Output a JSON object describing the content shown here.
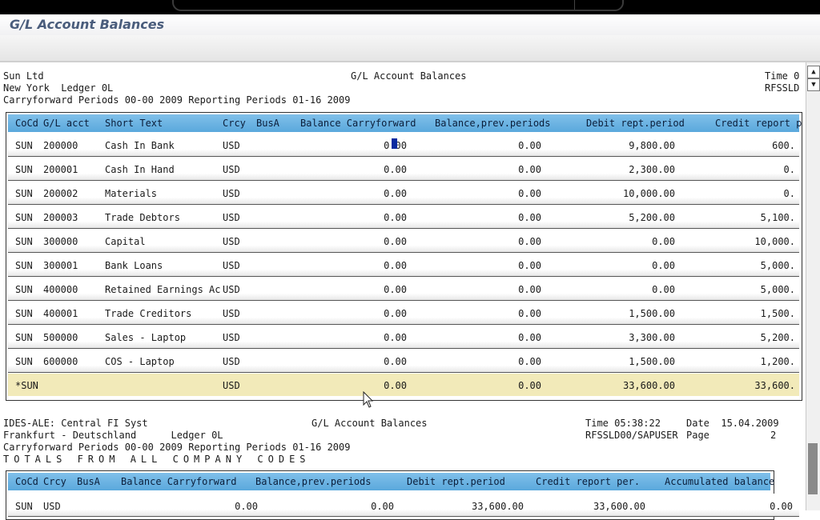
{
  "window": {
    "title": "G/L Account Balances"
  },
  "header1": {
    "company": "Sun Ltd",
    "location": "New York  Ledger 0L",
    "periods": "Carryforward Periods 00-00 2009 Reporting Periods 01-16 2009",
    "title": "G/L Account Balances",
    "time": "Time 0",
    "program": "RFSSLD"
  },
  "table1": {
    "headers": [
      "CoCd",
      "G/L acct",
      "Short Text",
      "Crcy",
      "BusA",
      "Balance Carryforward",
      "Balance,prev.periods",
      "Debit rept.period",
      "Credit report p"
    ],
    "rows": [
      {
        "cocd": "SUN",
        "acct": "200000",
        "text": "Cash In Bank",
        "crcy": "USD",
        "carry": "0.00",
        "prev": "0.00",
        "debit": "9,800.00",
        "credit": "600."
      },
      {
        "cocd": "SUN",
        "acct": "200001",
        "text": "Cash In Hand",
        "crcy": "USD",
        "carry": "0.00",
        "prev": "0.00",
        "debit": "2,300.00",
        "credit": "0."
      },
      {
        "cocd": "SUN",
        "acct": "200002",
        "text": "Materials",
        "crcy": "USD",
        "carry": "0.00",
        "prev": "0.00",
        "debit": "10,000.00",
        "credit": "0."
      },
      {
        "cocd": "SUN",
        "acct": "200003",
        "text": "Trade Debtors",
        "crcy": "USD",
        "carry": "0.00",
        "prev": "0.00",
        "debit": "5,200.00",
        "credit": "5,100."
      },
      {
        "cocd": "SUN",
        "acct": "300000",
        "text": "Capital",
        "crcy": "USD",
        "carry": "0.00",
        "prev": "0.00",
        "debit": "0.00",
        "credit": "10,000."
      },
      {
        "cocd": "SUN",
        "acct": "300001",
        "text": "Bank Loans",
        "crcy": "USD",
        "carry": "0.00",
        "prev": "0.00",
        "debit": "0.00",
        "credit": "5,000."
      },
      {
        "cocd": "SUN",
        "acct": "400000",
        "text": "Retained Earnings Ac",
        "crcy": "USD",
        "carry": "0.00",
        "prev": "0.00",
        "debit": "0.00",
        "credit": "5,000."
      },
      {
        "cocd": "SUN",
        "acct": "400001",
        "text": "Trade Creditors",
        "crcy": "USD",
        "carry": "0.00",
        "prev": "0.00",
        "debit": "1,500.00",
        "credit": "1,500."
      },
      {
        "cocd": "SUN",
        "acct": "500000",
        "text": "Sales - Laptop",
        "crcy": "USD",
        "carry": "0.00",
        "prev": "0.00",
        "debit": "3,300.00",
        "credit": "5,200."
      },
      {
        "cocd": "SUN",
        "acct": "600000",
        "text": "COS - Laptop",
        "crcy": "USD",
        "carry": "0.00",
        "prev": "0.00",
        "debit": "1,500.00",
        "credit": "1,200."
      }
    ],
    "total": {
      "cocd": "*SUN",
      "crcy": "USD",
      "carry": "0.00",
      "prev": "0.00",
      "debit": "33,600.00",
      "credit": "33,600."
    }
  },
  "header2": {
    "system": "IDES-ALE: Central FI Syst",
    "location": "Frankfurt - Deutschland      Ledger 0L",
    "periods": "Carryforward Periods 00-00 2009 Reporting Periods 01-16 2009",
    "totals": "TOTALS FROM ALL COMPANY CODES",
    "title": "G/L Account Balances",
    "time": "Time 05:38:22",
    "date": "Date  15.04.2009",
    "user": "RFSSLD00/SAPUSER",
    "page": "Page",
    "page_no": "2"
  },
  "table2": {
    "headers": [
      "CoCd",
      "Crcy",
      "BusA",
      "Balance Carryforward",
      "Balance,prev.periods",
      "Debit rept.period",
      "Credit report per.",
      "Accumulated balance"
    ],
    "row": {
      "cocd": "SUN",
      "crcy": "USD",
      "carry": "0.00",
      "prev": "0.00",
      "debit": "33,600.00",
      "credit": "33,600.00",
      "accum": "0.00"
    }
  },
  "icons": {
    "scroll_up": "arrow-up-icon",
    "scroll_down": "arrow-down-icon",
    "pointer": "mouse-pointer-icon"
  }
}
